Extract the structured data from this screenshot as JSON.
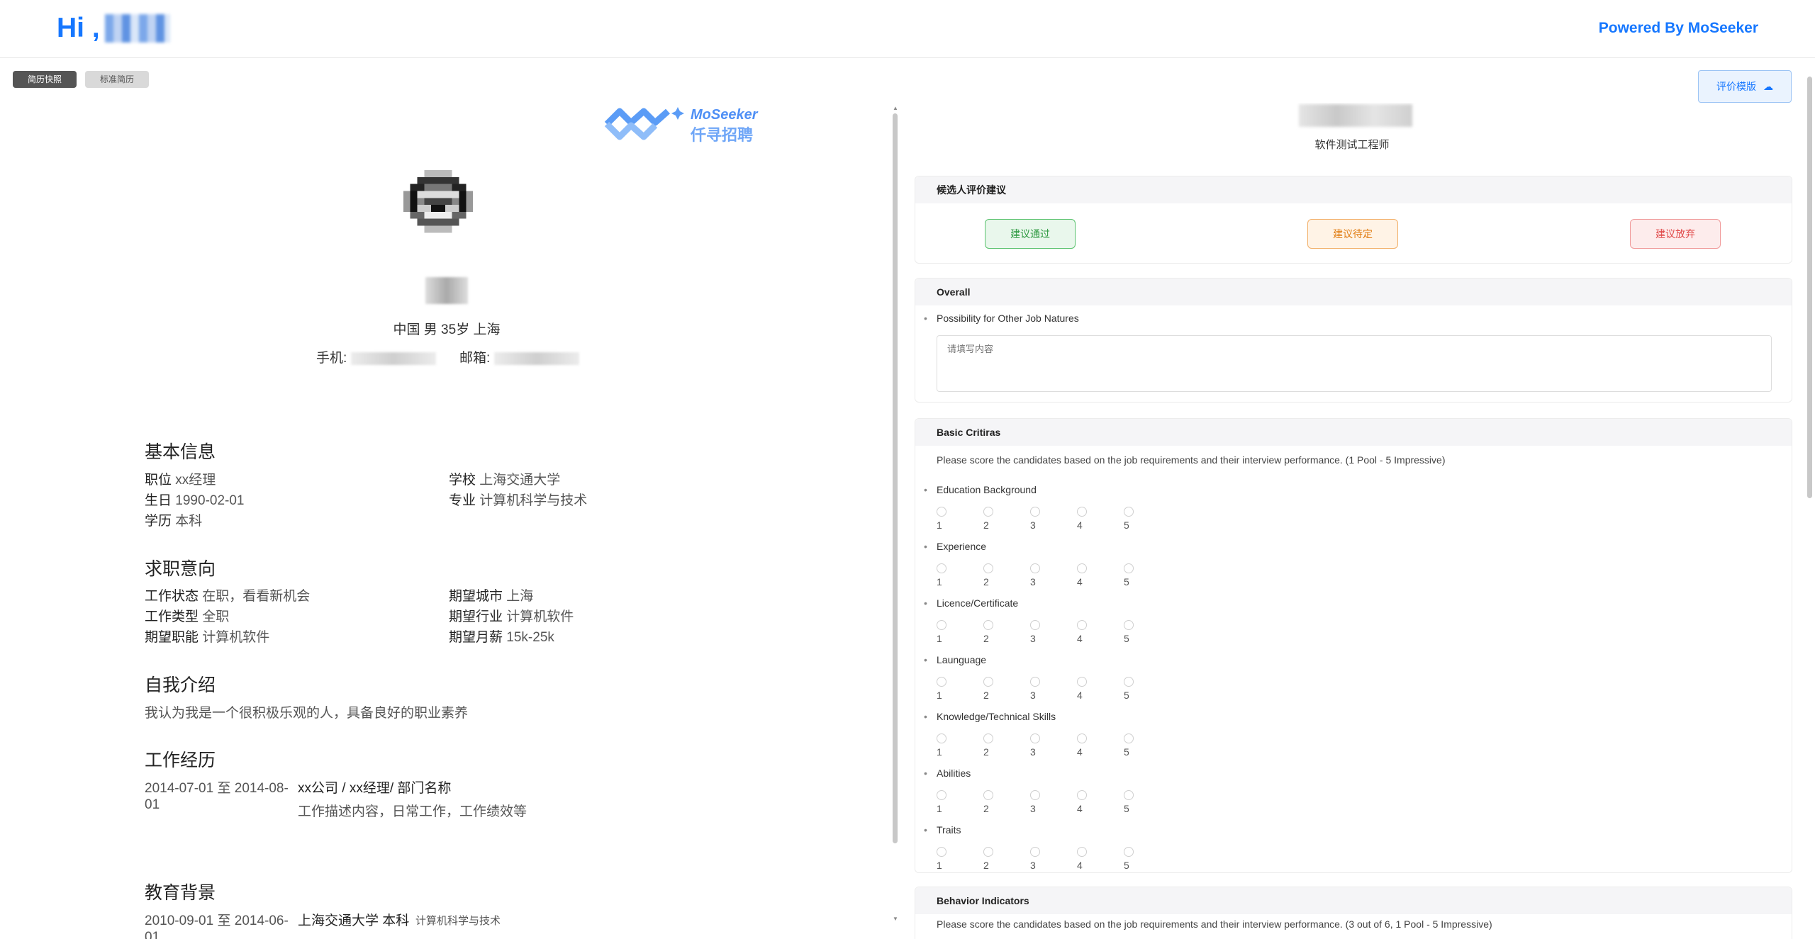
{
  "header": {
    "greeting": "Hi ,",
    "powered_by": "Powered By MoSeeker"
  },
  "tabs": [
    {
      "label": "简历快照",
      "active": true
    },
    {
      "label": "标准简历",
      "active": false
    }
  ],
  "resume": {
    "logo_en": "MoSeeker",
    "logo_cn": "仟寻招聘",
    "profile_line": "中国 男 35岁 上海",
    "phone_label": "手机:",
    "email_label": "邮箱:",
    "basic_info": {
      "title": "基本信息",
      "position_label": "职位",
      "position_value": "xx经理",
      "birthday_label": "生日",
      "birthday_value": "1990-02-01",
      "education_label": "学历",
      "education_value": "本科",
      "school_label": "学校",
      "school_value": "上海交通大学",
      "major_label": "专业",
      "major_value": "计算机科学与技术"
    },
    "job_intention": {
      "title": "求职意向",
      "status_label": "工作状态",
      "status_value": "在职，看看新机会",
      "type_label": "工作类型",
      "type_value": "全职",
      "function_label": "期望职能",
      "function_value": "计算机软件",
      "city_label": "期望城市",
      "city_value": "上海",
      "industry_label": "期望行业",
      "industry_value": "计算机软件",
      "salary_label": "期望月薪",
      "salary_value": "15k-25k"
    },
    "self_intro": {
      "title": "自我介绍",
      "text": "我认为我是一个很积极乐观的人，具备良好的职业素养"
    },
    "work_experience": {
      "title": "工作经历",
      "period_line1": "2014-07-01 至 2014-08-",
      "period_line2": "01",
      "company_role": "xx公司 / xx经理/ 部门名称",
      "description": "工作描述内容，日常工作，工作绩效等"
    },
    "education": {
      "title": "教育背景",
      "period_line1": "2010-09-01 至 2014-06-",
      "period_line2": "01",
      "school_degree": "上海交通大学 本科",
      "major": "计算机科学与技术"
    }
  },
  "evaluation": {
    "export_label": "评价模版",
    "position": "软件测试工程师",
    "suggestion": {
      "title": "候选人评价建议",
      "pass": "建议通过",
      "pending": "建议待定",
      "reject": "建议放弃"
    },
    "overall": {
      "title": "Overall",
      "question": "Possibility for Other Job Natures",
      "placeholder": "请填写内容"
    },
    "basic_criteria": {
      "title": "Basic Critiras",
      "note": "Please score the candidates based on the job requirements and their interview performance. (1 Pool - 5 Impressive)",
      "scale": [
        "1",
        "2",
        "3",
        "4",
        "5"
      ],
      "items": [
        "Education Background",
        "Experience",
        "Licence/Certificate",
        "Launguage",
        "Knowledge/Technical Skills",
        "Abilities",
        "Traits"
      ]
    },
    "behavior": {
      "title": "Behavior Indicators",
      "note": "Please score the candidates based on the job requirements and their interview performance. (3 out of 6, 1 Pool - 5 Impressive)"
    }
  }
}
